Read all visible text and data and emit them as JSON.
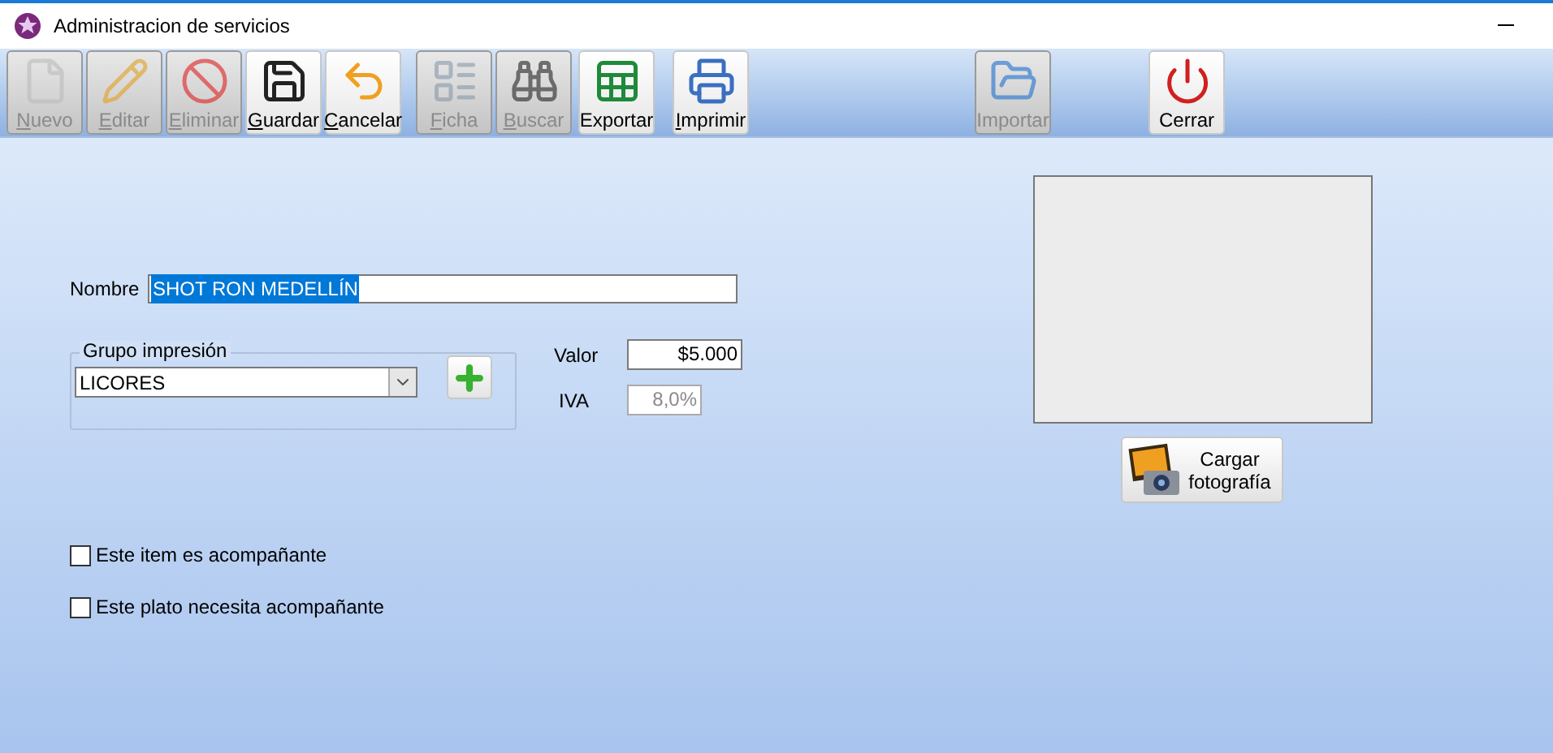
{
  "window": {
    "title": "Administracion de servicios"
  },
  "toolbar": [
    {
      "label": "Nuevo",
      "kind": "new",
      "disabled": true,
      "underline": true
    },
    {
      "label": "Editar",
      "kind": "edit",
      "disabled": true,
      "underline": true
    },
    {
      "label": "Eliminar",
      "kind": "delete",
      "disabled": true,
      "underline": true
    },
    {
      "label": "Guardar",
      "kind": "save",
      "disabled": false,
      "underline": true
    },
    {
      "label": "Cancelar",
      "kind": "cancel",
      "disabled": false,
      "underline": true
    },
    {
      "label": "Ficha",
      "kind": "sheet",
      "disabled": true,
      "underline": true
    },
    {
      "label": "Buscar",
      "kind": "search",
      "disabled": true,
      "underline": true
    },
    {
      "label": "Exportar",
      "kind": "excel",
      "disabled": false,
      "underline": false
    },
    {
      "label": "Imprimir",
      "kind": "print",
      "disabled": false,
      "underline": true
    },
    {
      "label": "Importar",
      "kind": "import",
      "disabled": true,
      "underline": false
    },
    {
      "label": "Cerrar",
      "kind": "close",
      "disabled": false,
      "underline": false
    }
  ],
  "form": {
    "nombre": {
      "label": "Nombre",
      "value": "SHOT RON MEDELLÍN",
      "highlighted": true
    },
    "grupo": {
      "legend": "Grupo impresión",
      "value": "LICORES"
    },
    "valor": {
      "label": "Valor",
      "value": "$5.000",
      "disabled": false
    },
    "iva": {
      "label": "IVA",
      "value": "8,0%",
      "disabled": true
    },
    "photo_button": {
      "label": "Cargar fotografía"
    },
    "checkboxes": [
      {
        "label": "Este item es acompañante",
        "checked": false
      },
      {
        "label": "Este plato necesita acompañante",
        "checked": false
      }
    ]
  }
}
